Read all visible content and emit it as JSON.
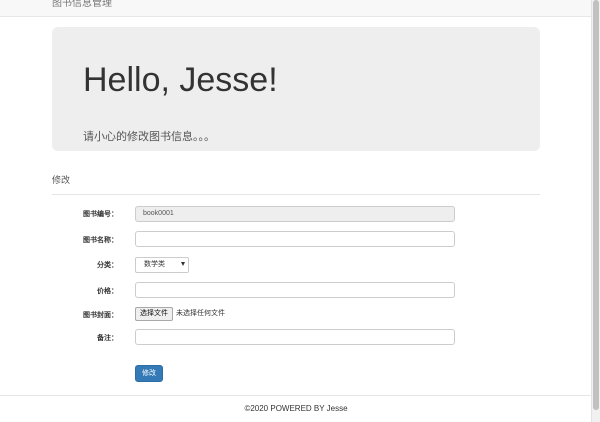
{
  "navbar": {
    "brand": "图书信息管理"
  },
  "jumbotron": {
    "heading": "Hello, Jesse!",
    "subtext": "请小心的修改图书信息。。。"
  },
  "form": {
    "section_title": "修改",
    "fields": {
      "book_id": {
        "label": "图书编号：",
        "value": "book0001"
      },
      "book_name": {
        "label": "图书名称：",
        "value": ""
      },
      "category": {
        "label": "分类：",
        "selected": "数学类"
      },
      "price": {
        "label": "价格：",
        "value": ""
      },
      "cover": {
        "label": "图书封面：",
        "button_label": "选择文件",
        "status": "未选择任何文件"
      },
      "note": {
        "label": "备注：",
        "value": ""
      }
    },
    "submit_label": "修改"
  },
  "footer": {
    "text": "©2020 POWERED BY Jesse"
  },
  "colors": {
    "primary_button": "#337ab7",
    "jumbotron_bg": "#eeeeee",
    "navbar_bg": "#f8f8f8"
  },
  "icons": {
    "select_caret": "caret-down-icon"
  }
}
